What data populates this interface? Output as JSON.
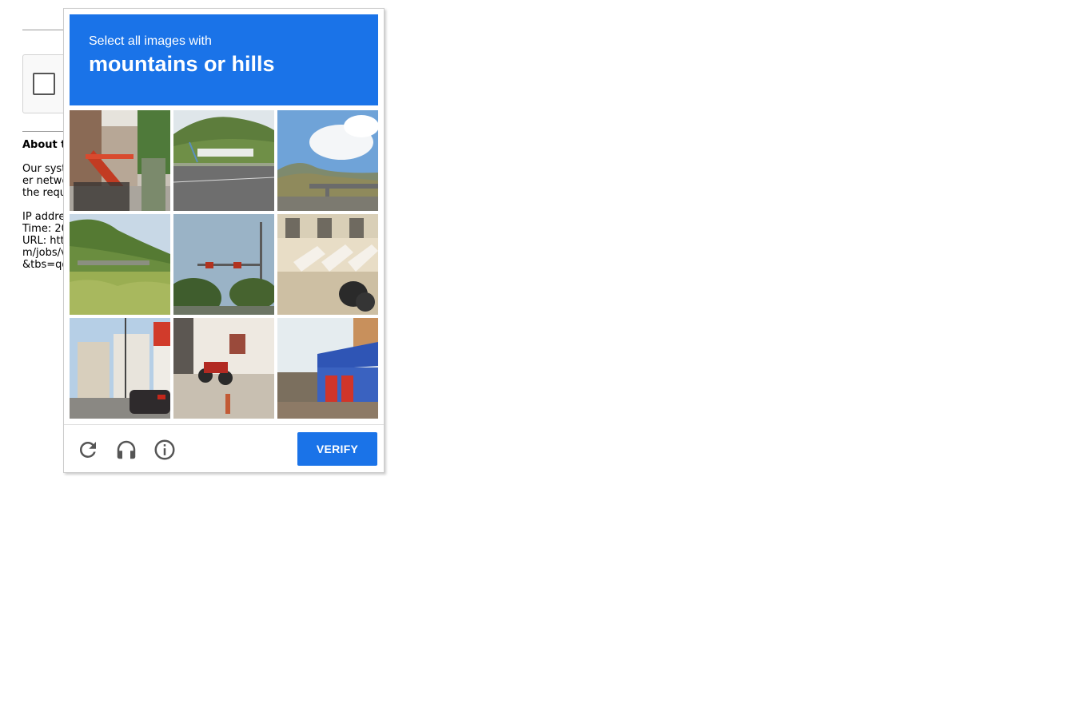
{
  "background_page": {
    "heading": "About t",
    "paragraph1": [
      "Our syst",
      "er netwo",
      "the requ"
    ],
    "paragraph2": [
      "IP addre",
      "Time: 20",
      "URL: htt",
      "m/jobs/v",
      "&tbs=qd"
    ]
  },
  "captcha": {
    "instruction": "Select all images with",
    "target": "mountains or hills",
    "tiles": [
      {
        "scene": "red staircase on building"
      },
      {
        "scene": "green hill over road with bridge"
      },
      {
        "scene": "hills and overpass under cloudy sky"
      },
      {
        "scene": "green hillside with bridge"
      },
      {
        "scene": "traffic light and palm trees"
      },
      {
        "scene": "white building with steps"
      },
      {
        "scene": "street with buildings and car"
      },
      {
        "scene": "motorcycle beside building"
      },
      {
        "scene": "shop fronts with red doors"
      }
    ],
    "footer": {
      "reload_icon": "reload-icon",
      "audio_icon": "headphones-icon",
      "info_icon": "info-icon",
      "verify_label": "VERIFY"
    }
  },
  "colors": {
    "accent": "#1a73e8",
    "icon": "#555555"
  }
}
